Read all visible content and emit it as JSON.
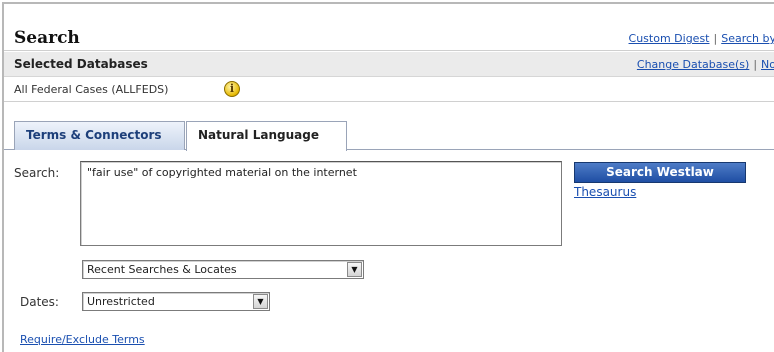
{
  "header": {
    "title": "Search",
    "links": [
      "Custom Digest",
      "Search by"
    ],
    "separator": "|"
  },
  "databases": {
    "label": "Selected Databases",
    "links": [
      "Change Database(s)",
      "No"
    ],
    "separator": "|",
    "selected": "All Federal Cases (ALLFEDS)",
    "info_icon": "info-icon"
  },
  "tabs": [
    {
      "label": "Terms & Connectors",
      "active": false
    },
    {
      "label": "Natural Language",
      "active": true
    }
  ],
  "search": {
    "label": "Search:",
    "query": "\"fair use\" of copyrighted material on the internet",
    "button_label": "Search Westlaw",
    "thesaurus_label": "Thesaurus",
    "recent_selected": "Recent Searches & Locates"
  },
  "dates": {
    "label": "Dates:",
    "selected": "Unrestricted"
  },
  "require_exclude_label": "Require/Exclude Terms",
  "colors": {
    "link": "#1a4fb0",
    "button": "#1f4ea3",
    "tab_inactive": "#c9d6ea"
  }
}
